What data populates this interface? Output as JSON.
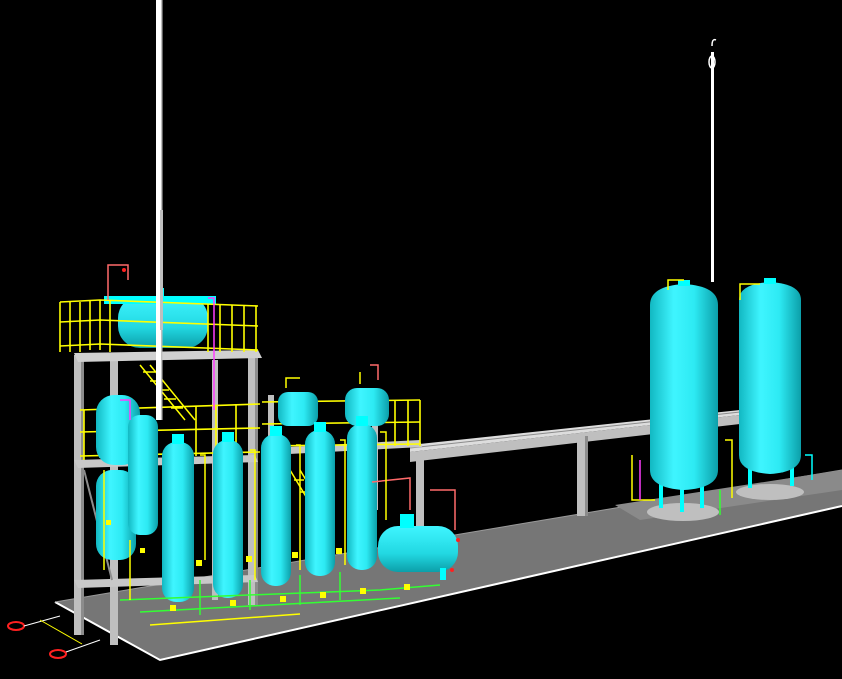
{
  "scene": {
    "background": "#000000",
    "colors": {
      "vessel": "#00FFFF",
      "vessel_shade": "#19C9D2",
      "vessel_dark": "#0A9AA3",
      "structure": "#BFBFBF",
      "structure_dark": "#8C8C8C",
      "platform": "#777777",
      "platform_edge": "#FFFFFF",
      "handrail": "#FFFF00",
      "pipe_red": "#FF6A6A",
      "pipe_magenta": "#FF3DFF",
      "pipe_green": "#33FF33",
      "stack": "#FFFFFF",
      "nozzle_red": "#FF2020"
    },
    "equipment": [
      {
        "id": "top-drum",
        "kind": "horizontal-vessel"
      },
      {
        "id": "column-1",
        "kind": "vertical-vessel"
      },
      {
        "id": "column-2",
        "kind": "vertical-vessel"
      },
      {
        "id": "column-3",
        "kind": "vertical-vessel"
      },
      {
        "id": "column-4",
        "kind": "vertical-vessel"
      },
      {
        "id": "column-5",
        "kind": "vertical-vessel"
      },
      {
        "id": "storage-tank-1",
        "kind": "vertical-tank"
      },
      {
        "id": "storage-tank-2",
        "kind": "vertical-tank"
      },
      {
        "id": "flare-stack-1",
        "kind": "vent-stack"
      },
      {
        "id": "flare-stack-2",
        "kind": "vent-stack"
      }
    ]
  }
}
